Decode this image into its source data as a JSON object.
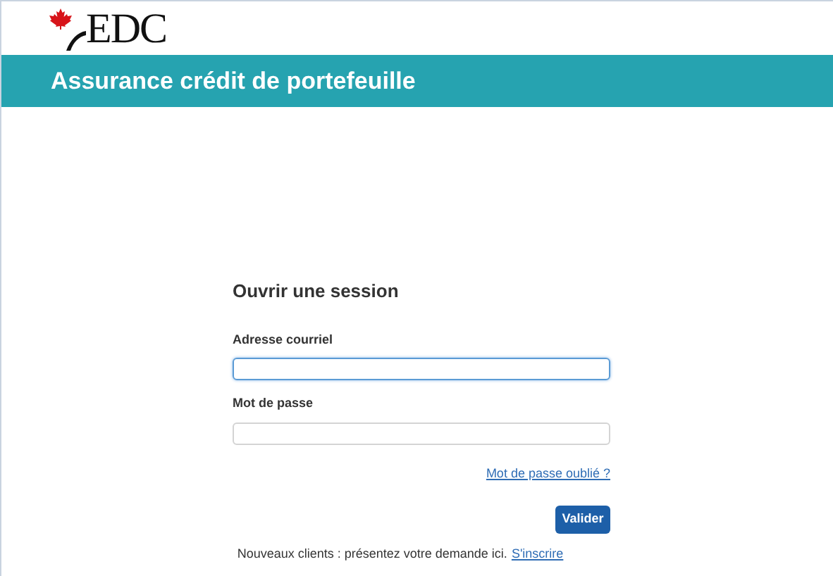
{
  "logo": {
    "text": "EDC"
  },
  "banner": {
    "title": "Assurance crédit de portefeuille"
  },
  "login": {
    "title": "Ouvrir une session",
    "fields": [
      {
        "label": "Adresse courriel",
        "focused": true
      },
      {
        "label": "Mot de passe",
        "focused": false
      }
    ],
    "forgot_link": "Mot de passe oublié ?",
    "submit": "Valider",
    "signup_text": "Nouveaux clients : présentez votre demande ici.",
    "signup_link": "S'inscrire"
  }
}
